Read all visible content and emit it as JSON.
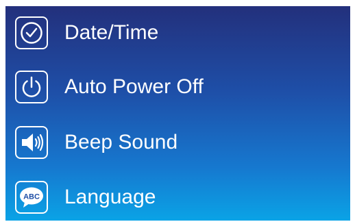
{
  "menu": {
    "items": [
      {
        "label": "Date/Time",
        "icon": "clock-icon"
      },
      {
        "label": "Auto Power Off",
        "icon": "power-icon"
      },
      {
        "label": "Beep Sound",
        "icon": "speaker-icon"
      },
      {
        "label": "Language",
        "icon": "language-abc-icon",
        "icon_text": "ABC"
      }
    ]
  },
  "colors": {
    "background_top": "#23307c",
    "background_bottom": "#0aa3e6",
    "foreground": "#ffffff"
  }
}
